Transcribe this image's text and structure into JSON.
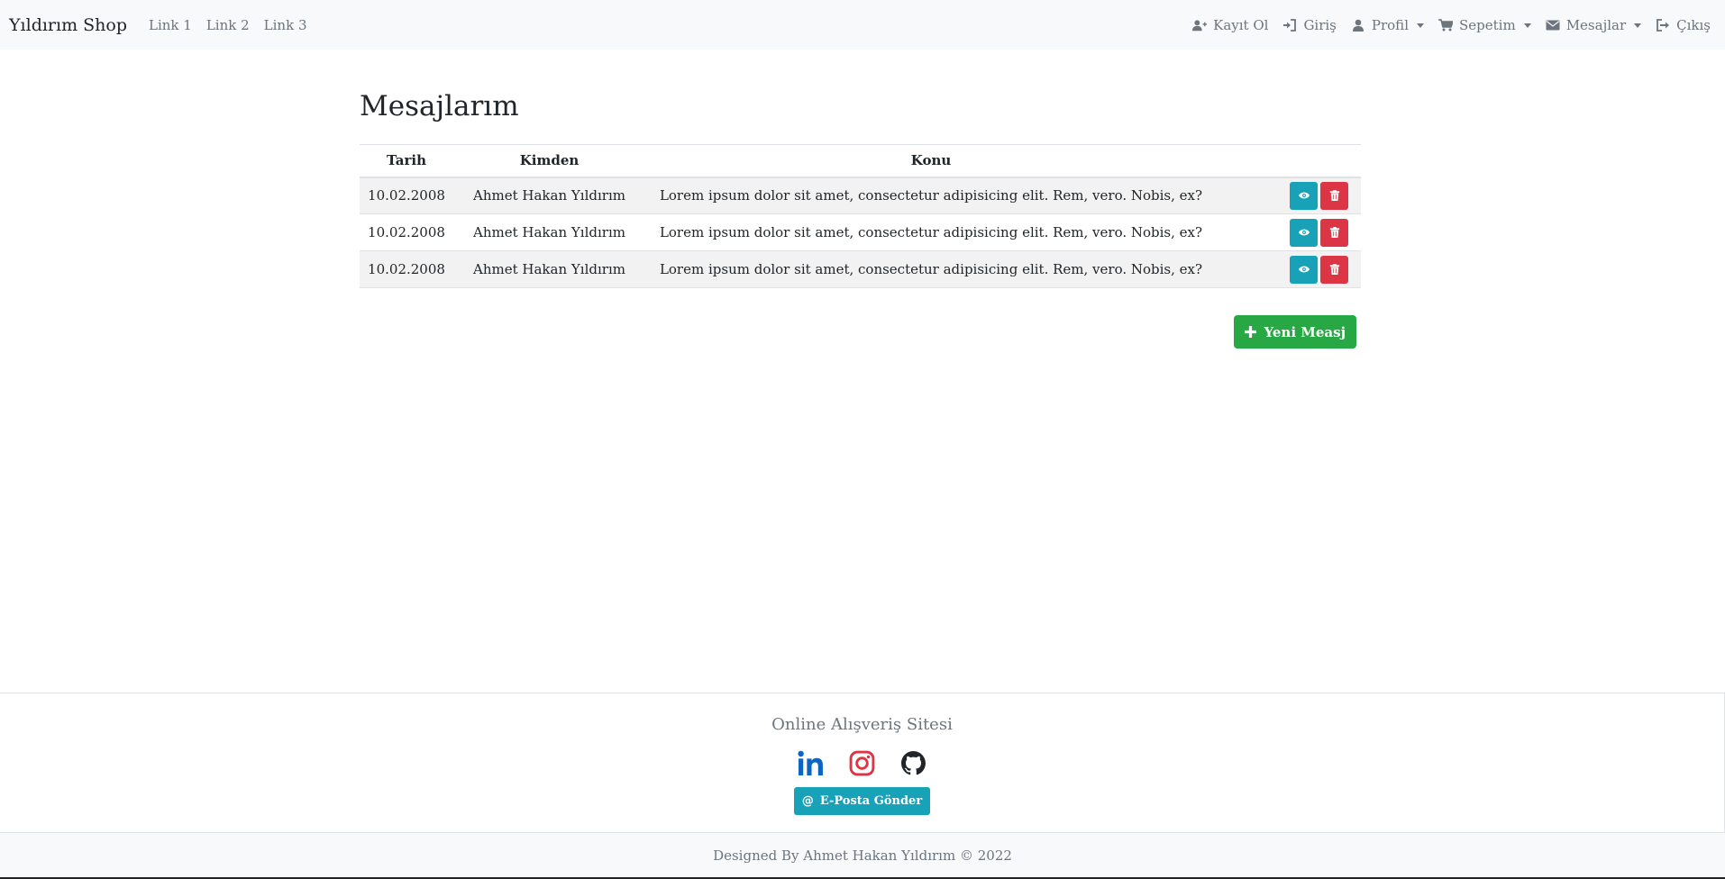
{
  "navbar": {
    "brand": "Yıldırım Shop",
    "left_links": [
      "Link 1",
      "Link 2",
      "Link 3"
    ],
    "register": "Kayıt Ol",
    "login": "Giriş",
    "profile": "Profil",
    "cart": "Sepetim",
    "messages": "Mesajlar",
    "logout": "Çıkış"
  },
  "main": {
    "title": "Mesajlarım",
    "table": {
      "headers": [
        "Tarih",
        "Kimden",
        "Konu",
        ""
      ],
      "rows": [
        {
          "date": "10.02.2008",
          "from": "Ahmet Hakan Yıldırım",
          "subject": "Lorem ipsum dolor sit amet, consectetur adipisicing elit. Rem, vero. Nobis, ex?"
        },
        {
          "date": "10.02.2008",
          "from": "Ahmet Hakan Yıldırım",
          "subject": "Lorem ipsum dolor sit amet, consectetur adipisicing elit. Rem, vero. Nobis, ex?"
        },
        {
          "date": "10.02.2008",
          "from": "Ahmet Hakan Yıldırım",
          "subject": "Lorem ipsum dolor sit amet, consectetur adipisicing elit. Rem, vero. Nobis, ex?"
        }
      ]
    },
    "new_message_label": "Yeni Measj"
  },
  "footer": {
    "title": "Online Alışveriş Sitesi",
    "email_button": "E-Posta Gönder",
    "copyright": "Designed By Ahmet Hakan Yıldırım © 2022"
  },
  "icons": {
    "register": "user-plus-icon",
    "login": "sign-in-icon",
    "profile": "user-icon",
    "cart": "shopping-cart-icon",
    "messages": "envelope-icon",
    "logout": "sign-out-icon",
    "view": "eye-icon",
    "delete": "trash-icon",
    "add": "plus-icon",
    "linkedin": "linkedin-icon",
    "instagram": "instagram-icon",
    "github": "github-icon",
    "at": "at-icon"
  },
  "colors": {
    "info": "#17a2b8",
    "danger": "#dc3545",
    "success": "#28a745",
    "linkedin": "#0a66c2",
    "instagram": "#dc3545",
    "github": "#212529",
    "muted": "#6c757d"
  }
}
